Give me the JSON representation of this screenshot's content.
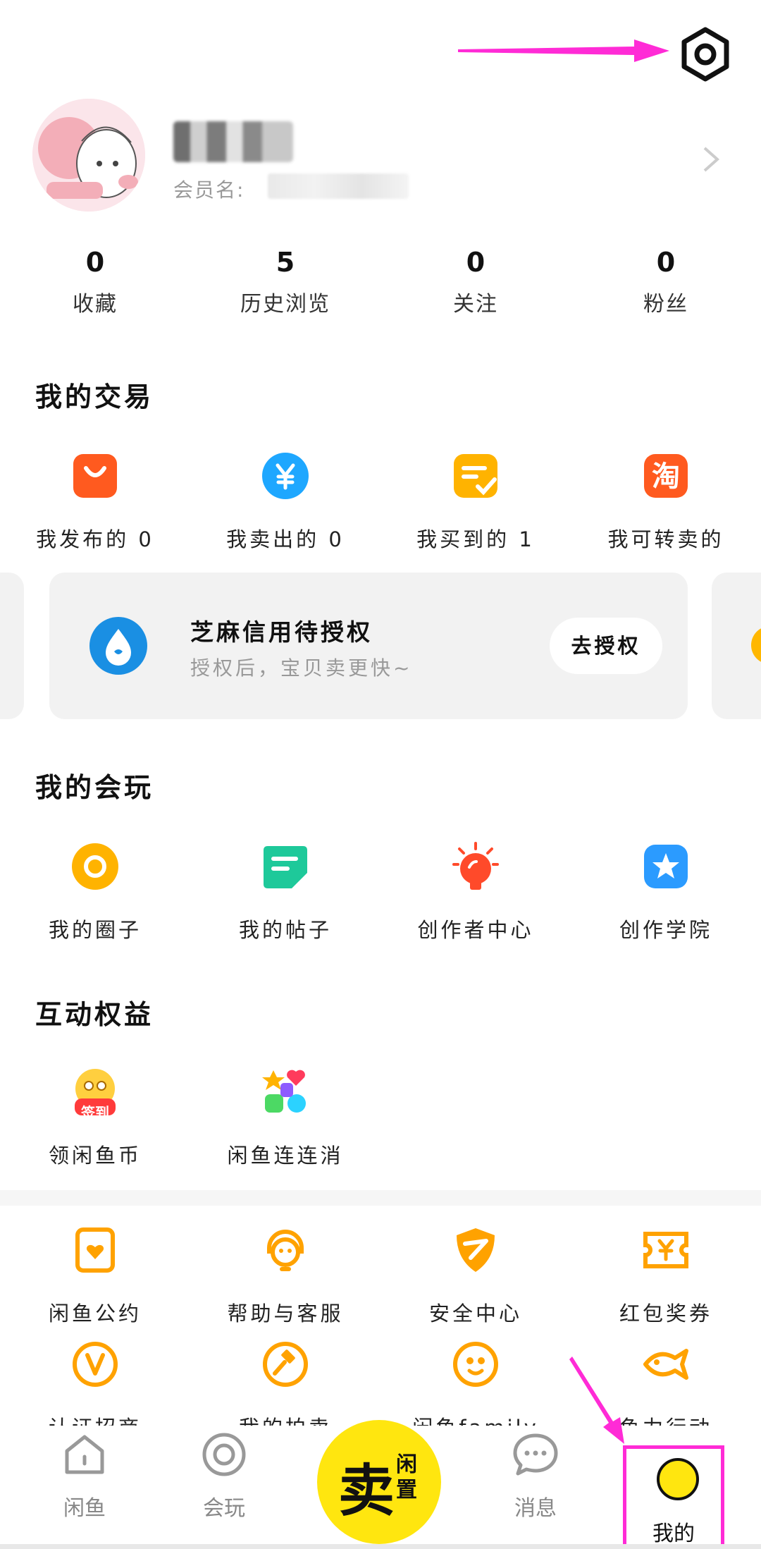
{
  "profile": {
    "member_label": "会员名:"
  },
  "stats": [
    {
      "value": "0",
      "label": "收藏"
    },
    {
      "value": "5",
      "label": "历史浏览"
    },
    {
      "value": "0",
      "label": "关注"
    },
    {
      "value": "0",
      "label": "粉丝"
    }
  ],
  "sections": {
    "trade": "我的交易",
    "play": "我的会玩",
    "rights": "互动权益"
  },
  "trade_items": [
    {
      "label": "我发布的 0",
      "icon": "shopping-bag-icon",
      "color": "#ff5a1f"
    },
    {
      "label": "我卖出的 0",
      "icon": "yen-icon",
      "color": "#1ea7ff"
    },
    {
      "label": "我买到的 1",
      "icon": "checklist-icon",
      "color": "#ffb300"
    },
    {
      "label": "我可转卖的",
      "icon": "taobao-icon",
      "color": "#ff5a1f"
    }
  ],
  "banner": {
    "title": "芝麻信用待授权",
    "subtitle": "授权后，宝贝卖更快~",
    "button": "去授权",
    "icon": "sesame-credit-icon",
    "icon_color": "#1a8fe3"
  },
  "play_items": [
    {
      "label": "我的圈子",
      "icon": "circle-icon",
      "color": "#ffb300"
    },
    {
      "label": "我的帖子",
      "icon": "post-icon",
      "color": "#1ec99a"
    },
    {
      "label": "创作者中心",
      "icon": "bulb-icon",
      "color": "#ff4a2a"
    },
    {
      "label": "创作学院",
      "icon": "star-badge-icon",
      "color": "#2b9bff"
    }
  ],
  "rights_items": [
    {
      "label": "领闲鱼币",
      "icon": "checkin-icon",
      "badge": "签到"
    },
    {
      "label": "闲鱼连连消",
      "icon": "match-game-icon"
    }
  ],
  "service_items": [
    {
      "label": "闲鱼公约",
      "icon": "pact-icon"
    },
    {
      "label": "帮助与客服",
      "icon": "headset-icon"
    },
    {
      "label": "安全中心",
      "icon": "shield-icon"
    },
    {
      "label": "红包奖券",
      "icon": "coupon-icon"
    },
    {
      "label": "认证招商",
      "icon": "verify-icon"
    },
    {
      "label": "我的拍卖",
      "icon": "auction-hammer-icon"
    },
    {
      "label": "闲鱼family",
      "icon": "family-icon"
    },
    {
      "label": "鱼力行动",
      "icon": "fish-heart-icon"
    }
  ],
  "service_color": "#ffa200",
  "tabs": [
    {
      "label": "闲鱼",
      "icon": "home-icon"
    },
    {
      "label": "会玩",
      "icon": "play-icon"
    },
    {
      "label": "消息",
      "icon": "message-icon"
    },
    {
      "label": "我的",
      "icon": "mine-icon"
    }
  ],
  "sell": {
    "big": "卖",
    "small": "闲置"
  },
  "annotation_color": "#ff2bd6"
}
